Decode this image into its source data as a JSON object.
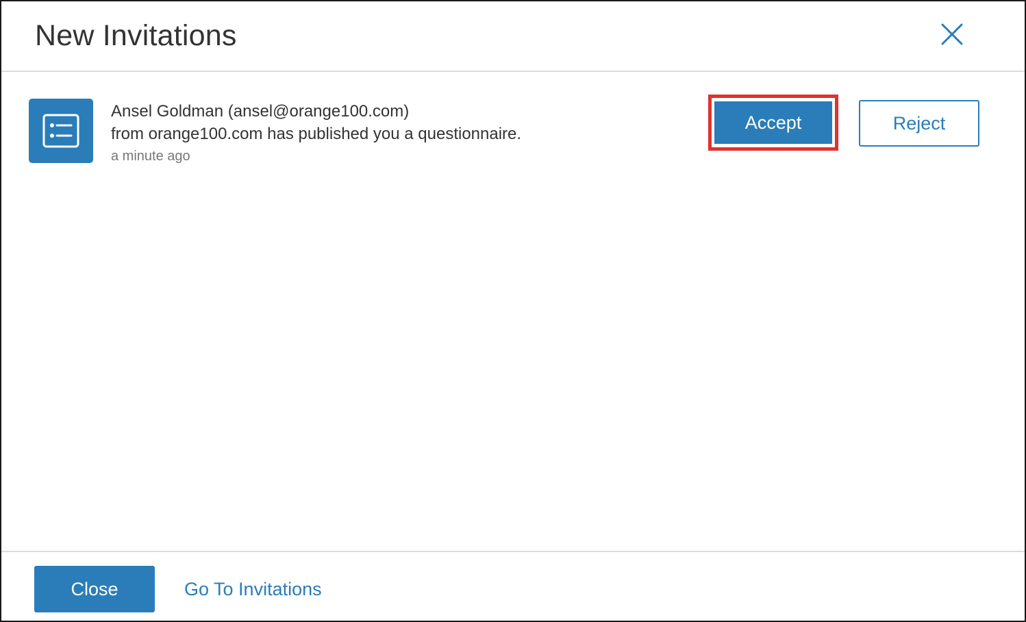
{
  "dialog": {
    "title": "New Invitations",
    "close_icon": "close-x-icon"
  },
  "invitation": {
    "icon": "questionnaire-list-icon",
    "sender": "Ansel Goldman (ansel@orange100.com)",
    "message": "from orange100.com has published you a questionnaire.",
    "time": "a minute ago",
    "accept_label": "Accept",
    "reject_label": "Reject"
  },
  "footer": {
    "close_label": "Close",
    "go_to_label": "Go To Invitations"
  },
  "colors": {
    "primary": "#2a7db8",
    "highlight": "#e0322e",
    "text": "#333333",
    "muted": "#777777",
    "divider": "#dcdcdc"
  }
}
